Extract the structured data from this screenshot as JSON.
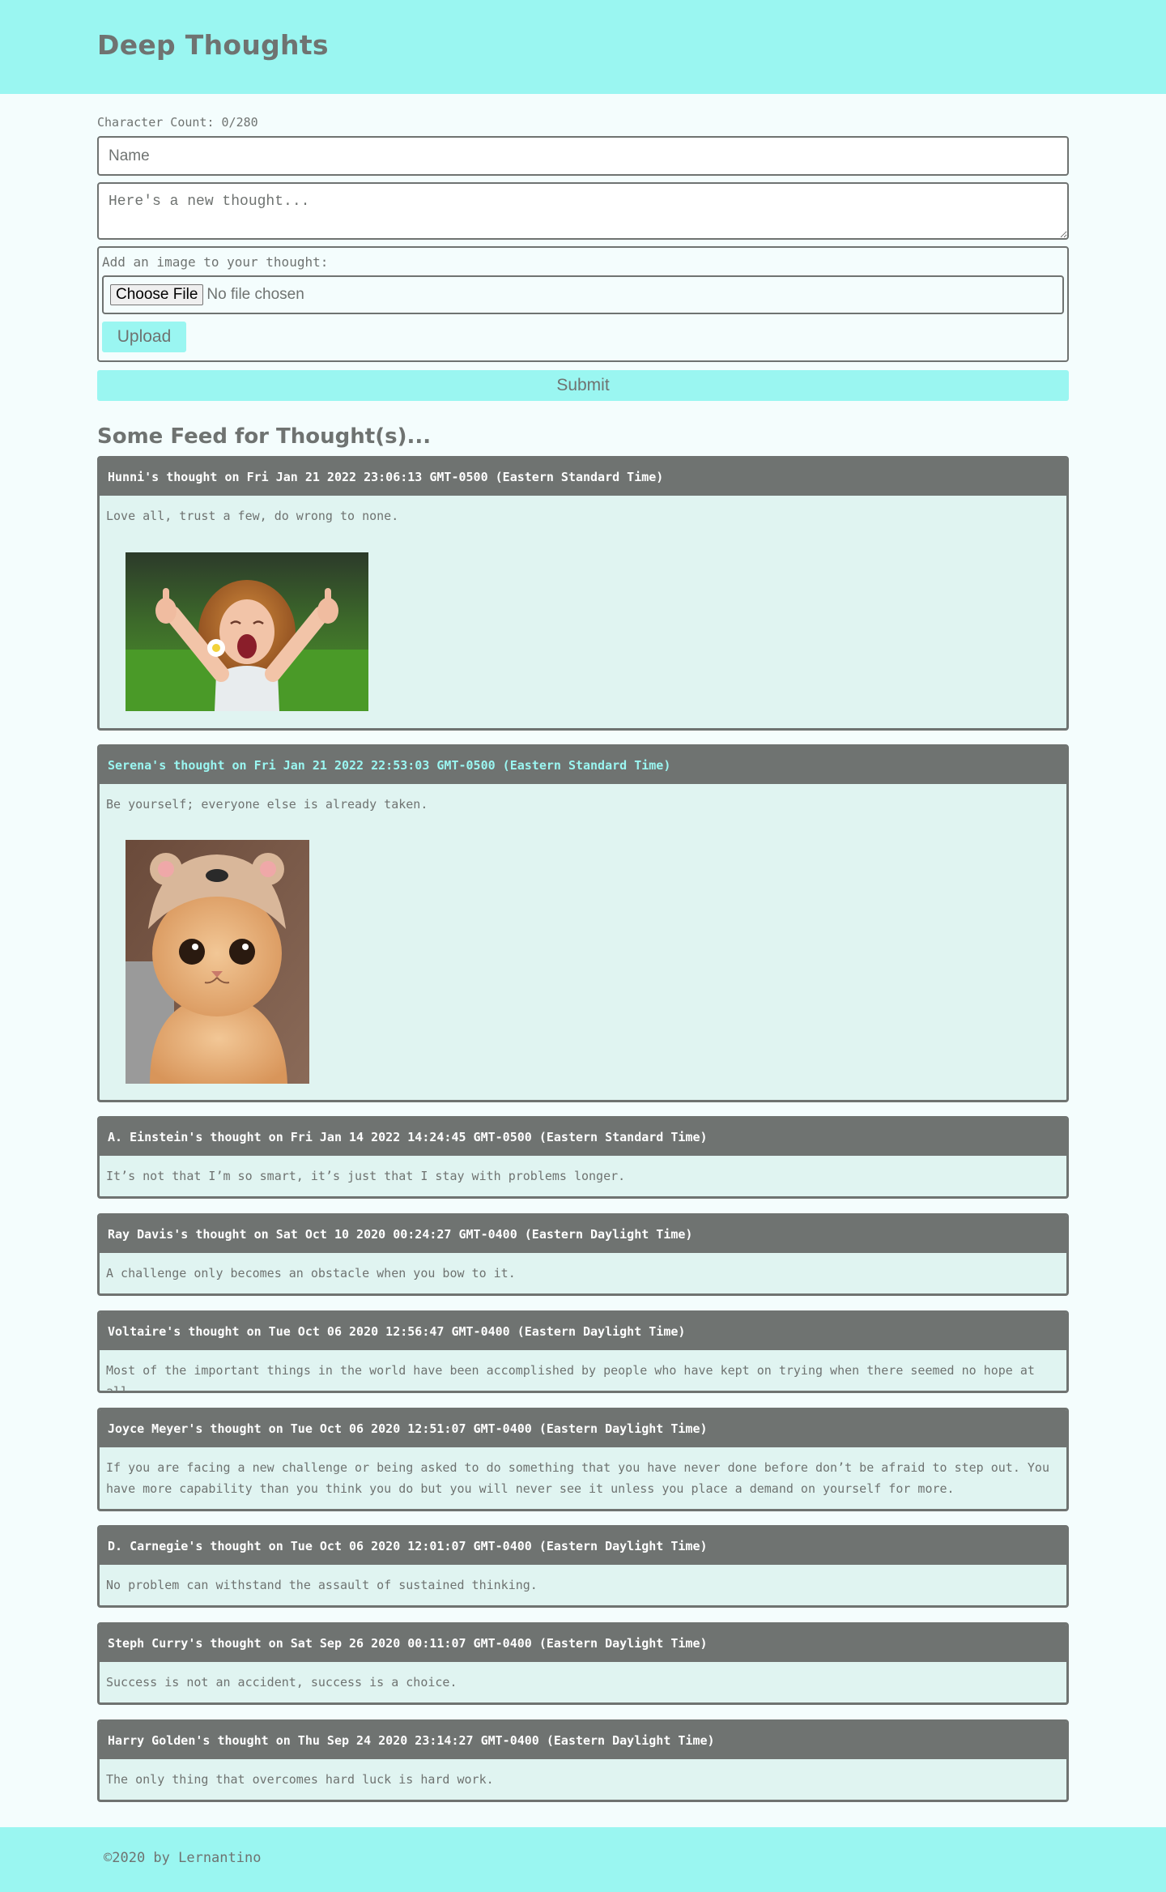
{
  "header": {
    "title": "Deep Thoughts"
  },
  "form": {
    "char_count": "Character Count: 0/280",
    "name_placeholder": "Name",
    "thought_placeholder": "Here's a new thought...",
    "image_label": "Add an image to your thought:",
    "choose_file_label": "Choose File",
    "no_file_text": "No file chosen",
    "upload_label": "Upload",
    "submit_label": "Submit"
  },
  "feed": {
    "title": "Some Feed for Thought(s)...",
    "thoughts": [
      {
        "heading": "Hunni's thought on Fri Jan 21 2022 23:06:13 GMT-0500 (Eastern Standard Time)",
        "text": "Love all, trust a few, do wrong to none.",
        "image": "girl-thumbs-up-photo"
      },
      {
        "heading": "Serena's thought on Fri Jan 21 2022 22:53:03 GMT-0500 (Eastern Standard Time)",
        "text": "Be yourself; everyone else is already taken.",
        "image": "cat-in-hat-photo"
      },
      {
        "heading": "A. Einstein's thought on Fri Jan 14 2022 14:24:45 GMT-0500 (Eastern Standard Time)",
        "text": "It’s not that I’m so smart, it’s just that I stay with problems longer."
      },
      {
        "heading": "Ray Davis's thought on Sat Oct 10 2020 00:24:27 GMT-0400 (Eastern Daylight Time)",
        "text": "A challenge only becomes an obstacle when you bow to it."
      },
      {
        "heading": "Voltaire's thought on Tue Oct 06 2020 12:56:47 GMT-0400 (Eastern Daylight Time)",
        "text": "Most of the important things in the world have been accomplished by people who have kept on trying when there seemed no hope at all."
      },
      {
        "heading": "Joyce Meyer's thought on Tue Oct 06 2020 12:51:07 GMT-0400 (Eastern Daylight Time)",
        "text": "If you are facing a new challenge or being asked to do something that you have never done before don’t be afraid to step out. You have more capability than you think you do but you will never see it unless you place a demand on yourself for more."
      },
      {
        "heading": "D. Carnegie's thought on Tue Oct 06 2020 12:01:07 GMT-0400 (Eastern Daylight Time)",
        "text": "No problem can withstand the assault of sustained thinking."
      },
      {
        "heading": "Steph Curry's thought on Sat Sep 26 2020 00:11:07 GMT-0400 (Eastern Daylight Time)",
        "text": "Success is not an accident, success is a choice."
      },
      {
        "heading": "Harry Golden's thought on Thu Sep 24 2020 23:14:27 GMT-0400 (Eastern Daylight Time)",
        "text": "The only thing that overcomes hard luck is hard work."
      }
    ]
  },
  "footer": {
    "text": "©2020 by Lernantino"
  },
  "colors": {
    "accent": "#9af6f1",
    "text": "#6f7371",
    "card_bg": "#e0f4f1",
    "page_bg": "#f4fdfd"
  }
}
